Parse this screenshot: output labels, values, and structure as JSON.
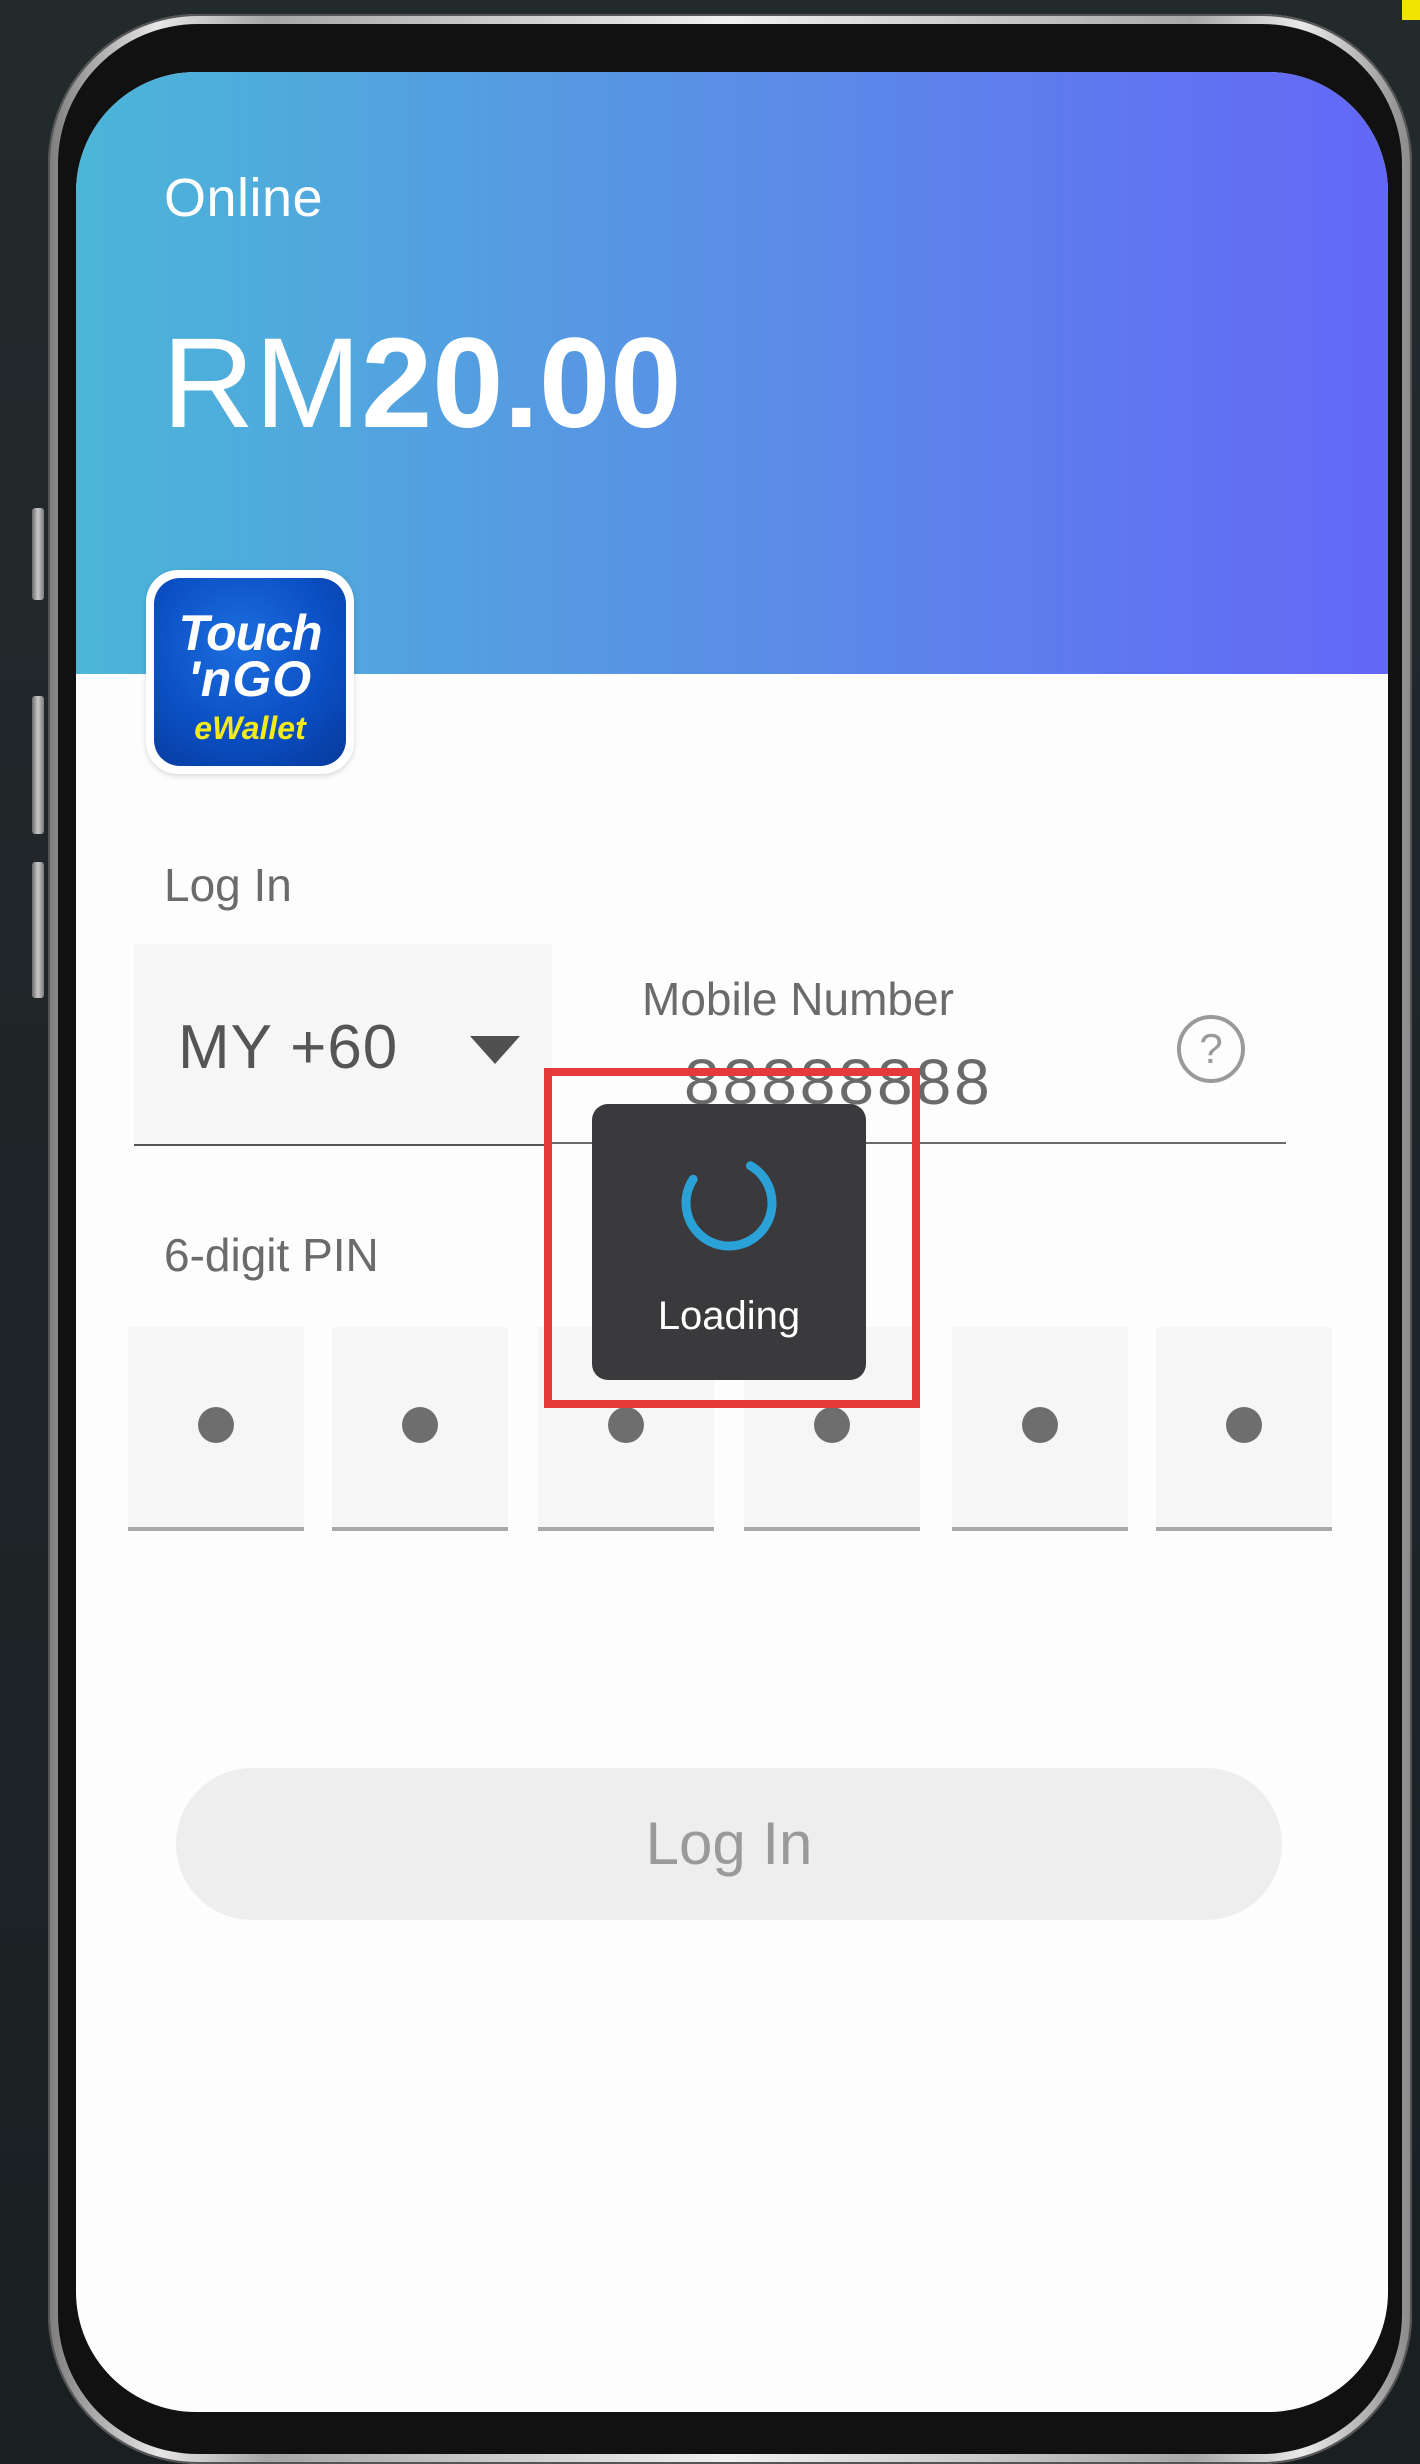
{
  "header": {
    "status": "Online",
    "balance_currency": "RM",
    "balance_amount": "20.00"
  },
  "logo": {
    "line1": "Touch",
    "line2": "'nGO",
    "line3": "eWallet"
  },
  "login_form": {
    "title": "Log In",
    "country_code": "MY +60",
    "mobile_label": "Mobile Number",
    "mobile_value": "88888888",
    "help_glyph": "?",
    "pin_label": "6-digit PIN",
    "pin_dots": [
      "●",
      "●",
      "●",
      "●",
      "●",
      "●"
    ],
    "submit_label": "Log In"
  },
  "loading": {
    "text": "Loading"
  },
  "colors": {
    "header_start": "#4bb6d8",
    "header_end": "#6367f7",
    "highlight": "#e53a3a",
    "toast_bg": "#3a3a3c",
    "spinner": "#2aa2d8"
  },
  "icons": {
    "dropdown": "caret-down-icon",
    "help": "question-circle-icon",
    "spinner": "spinner-icon"
  }
}
